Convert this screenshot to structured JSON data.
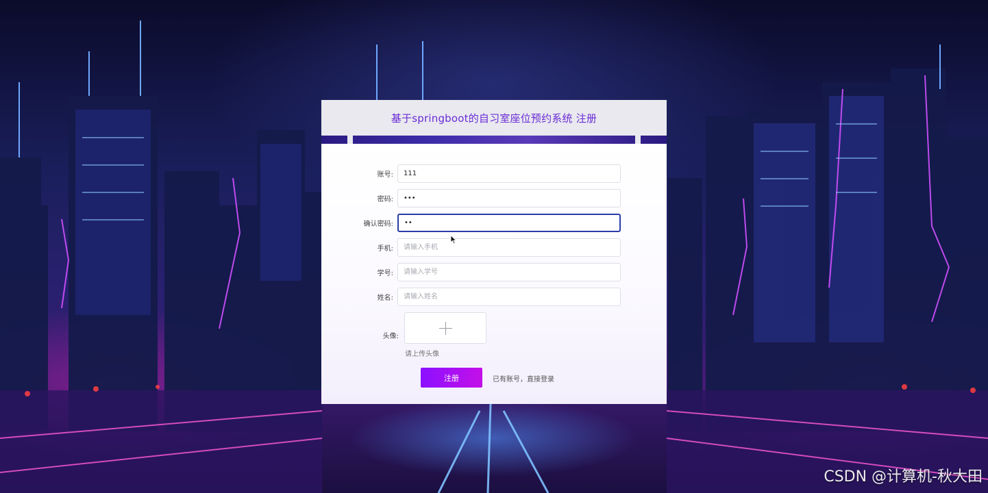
{
  "panel": {
    "title": "基于springboot的自习室座位预约系统 注册"
  },
  "form": {
    "fields": [
      {
        "label": "账号:",
        "value": "111",
        "placeholder": ""
      },
      {
        "label": "密码:",
        "value": "•••",
        "placeholder": ""
      },
      {
        "label": "确认密码:",
        "value": "••",
        "placeholder": ""
      },
      {
        "label": "手机:",
        "value": "",
        "placeholder": "请输入手机"
      },
      {
        "label": "学号:",
        "value": "",
        "placeholder": "请输入学号"
      },
      {
        "label": "姓名:",
        "value": "",
        "placeholder": "请输入姓名"
      }
    ],
    "avatar_label": "头像:",
    "avatar_tip": "请上传头像",
    "register_button": "注册",
    "login_link": "已有账号，直接登录"
  },
  "colors": {
    "title": "#6b2cd6",
    "button_start": "#8b10ff",
    "button_end": "#c410e8",
    "focus_border": "#2b3ca8"
  },
  "watermark": "CSDN @计算机-秋大田"
}
